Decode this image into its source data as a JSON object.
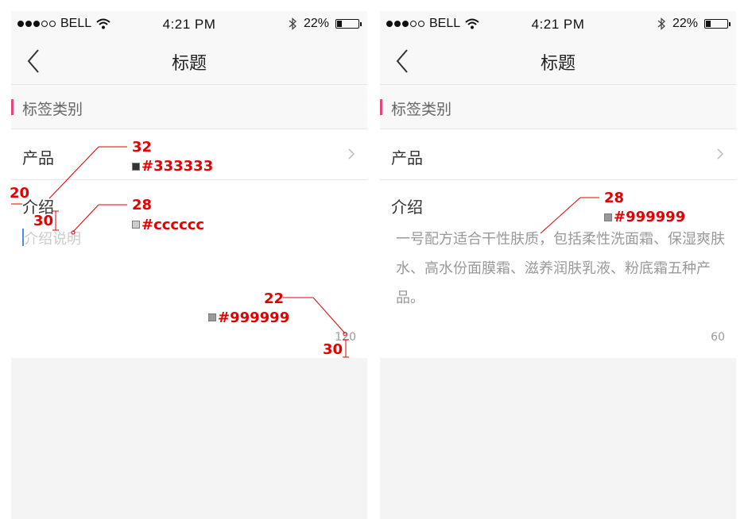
{
  "screens": [
    {
      "id": "edit",
      "status": {
        "carrier": "BELL",
        "time": "4:21 PM",
        "battery_pct": "22%",
        "battery_level": 0.22
      },
      "nav": {
        "title": "标题"
      },
      "section": {
        "label": "标签类别",
        "accent_color": "#e8457a"
      },
      "product_row": {
        "label": "产品"
      },
      "intro": {
        "label": "介绍",
        "placeholder": "介绍说明",
        "counter": "120"
      }
    },
    {
      "id": "filled",
      "status": {
        "carrier": "BELL",
        "time": "4:21 PM",
        "battery_pct": "22%",
        "battery_level": 0.22
      },
      "nav": {
        "title": "标题"
      },
      "section": {
        "label": "标签类别",
        "accent_color": "#e8457a"
      },
      "product_row": {
        "label": "产品"
      },
      "intro": {
        "label": "介绍",
        "text": "一号配方适合干性肤质，包括柔性洗面霜、保湿爽肤水、高水份面膜霜、滋养润肤乳液、粉底霜五种产品。",
        "counter": "60"
      }
    }
  ],
  "annotations": {
    "color": "#e30000",
    "items": [
      {
        "value": "32",
        "swatch_color": "#333333",
        "swatch_label": "#333333"
      },
      {
        "value": "20"
      },
      {
        "value": "30"
      },
      {
        "value": "28",
        "swatch_color": "#cccccc",
        "swatch_label": "#cccccc"
      },
      {
        "value": "22",
        "swatch_color": "#999999",
        "swatch_label": "#999999"
      },
      {
        "value": "30"
      },
      {
        "value": "28",
        "swatch_color": "#999999",
        "swatch_label": "#999999"
      }
    ]
  }
}
